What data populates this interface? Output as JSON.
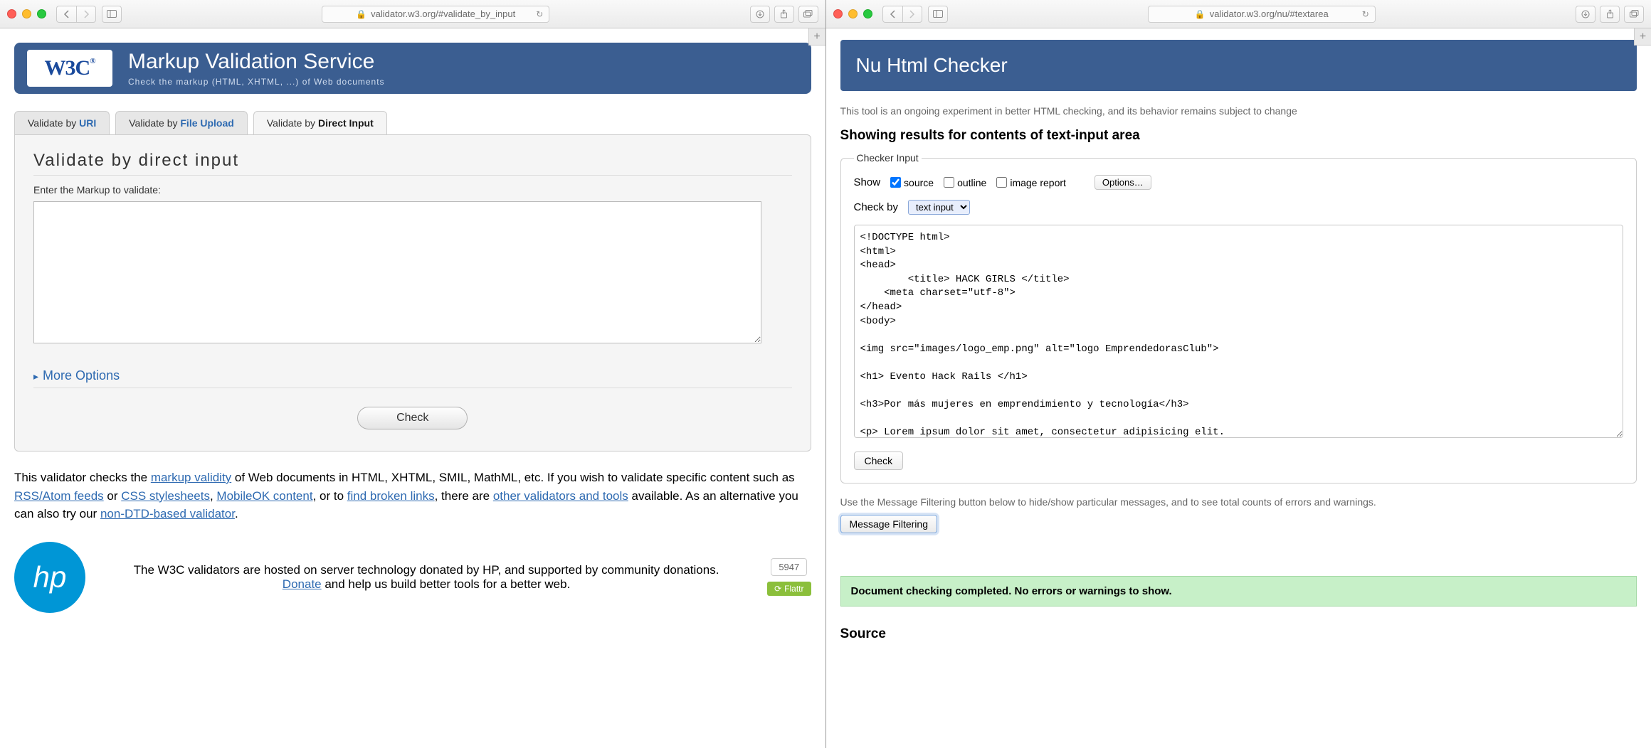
{
  "left": {
    "url": "validator.w3.org/#validate_by_input",
    "logo": "W3C",
    "title": "Markup Validation Service",
    "subtitle": "Check the markup (HTML, XHTML, ...) of Web documents",
    "tabs": {
      "uri_prefix": "Validate by ",
      "uri_link": "URI",
      "upload_prefix": "Validate by ",
      "upload_link": "File Upload",
      "direct_prefix": "Validate by ",
      "direct_bold": "Direct Input"
    },
    "panel": {
      "heading": "Validate by direct input",
      "label": "Enter the Markup to validate:",
      "more": "More Options",
      "check": "Check"
    },
    "desc": {
      "t1": "This validator checks the ",
      "l1": "markup validity",
      "t2": " of Web documents in HTML, XHTML, SMIL, MathML, etc. If you wish to validate specific content such as ",
      "l2": "RSS/Atom feeds",
      "t3": " or ",
      "l3": "CSS stylesheets",
      "t4": ", ",
      "l4": "MobileOK content",
      "t5": ", or to ",
      "l5": "find broken links",
      "t6": ", there are ",
      "l6": "other validators and tools",
      "t7": " available. As an alternative you can also try our ",
      "l7": "non-DTD-based validator",
      "t8": "."
    },
    "footer": {
      "hp": "hp",
      "text1": "The W3C validators are hosted on server technology donated by HP, and supported by community donations.",
      "donate": "Donate",
      "text2": " and help us build better tools for a better web.",
      "count": "5947",
      "flattr": "Flattr"
    }
  },
  "right": {
    "url": "validator.w3.org/nu/#textarea",
    "title": "Nu Html Checker",
    "note": "This tool is an ongoing experiment in better HTML checking, and its behavior remains subject to change",
    "results_heading": "Showing results for contents of text-input area",
    "legend": "Checker Input",
    "show_label": "Show",
    "show": {
      "source": "source",
      "outline": "outline",
      "image": "image report"
    },
    "source_checked": true,
    "options": "Options…",
    "checkby_label": "Check by",
    "checkby_value": "text input",
    "source_text": "<!DOCTYPE html>\n<html>\n<head>\n        <title> HACK GIRLS </title>\n    <meta charset=\"utf-8\">\n</head>\n<body>\n\n<img src=\"images/logo_emp.png\" alt=\"logo EmprendedorasClub\">\n\n<h1> Evento Hack Rails </h1>\n\n<h3>Por más mujeres en emprendimiento y tecnología</h3>\n\n<p> Lorem ipsum dolor sit amet, consectetur adipisicing elit.",
    "check": "Check",
    "filter_note": "Use the Message Filtering button below to hide/show particular messages, and to see total counts of errors and warnings.",
    "filter_btn": "Message Filtering",
    "success": "Document checking completed. No errors or warnings to show.",
    "source_heading": "Source"
  }
}
